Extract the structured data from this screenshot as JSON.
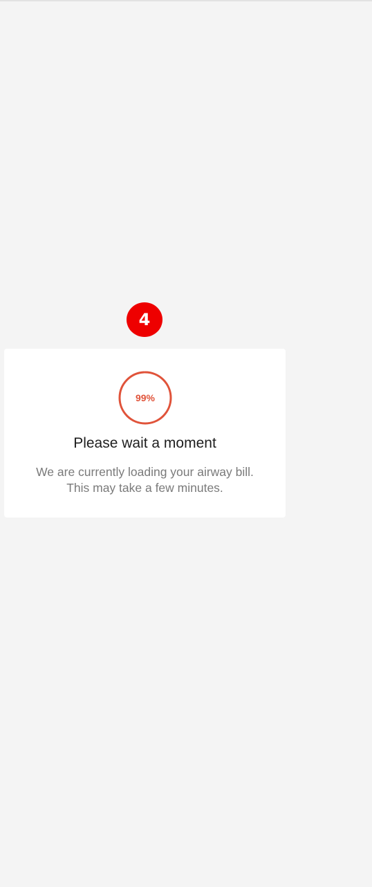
{
  "step_badge": "4",
  "loading_dialog": {
    "progress_text": "99%",
    "progress_fraction": 0.99,
    "title": "Please wait a moment",
    "message_line1": "We are currently loading your airway bill.",
    "message_line2": "This may take a few minutes."
  },
  "colors": {
    "badge": "#ee0000",
    "progress_accent": "#e0533a",
    "background": "#f4f4f4",
    "card": "#ffffff"
  }
}
